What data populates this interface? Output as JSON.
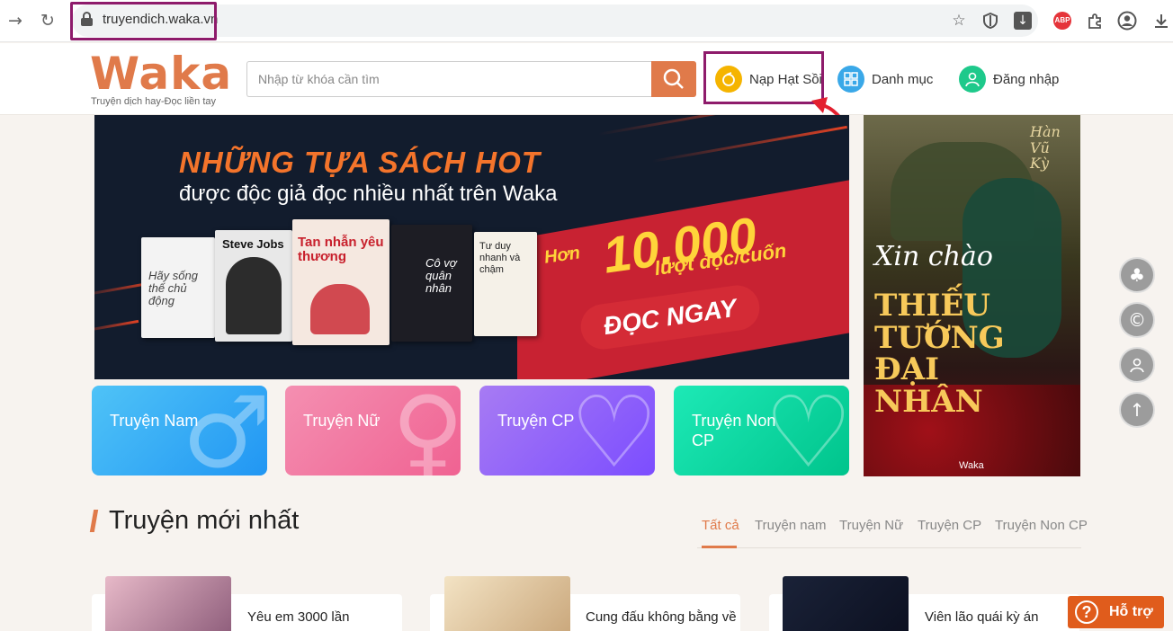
{
  "browser": {
    "back_icon": "back-arrow-icon",
    "reload_icon": "reload-icon",
    "url": "truyendich.waka.vn",
    "toolbar_icons": [
      "star-icon",
      "shield-icon",
      "download-arrow-icon",
      "abp-icon",
      "puzzle-icon",
      "profile-icon",
      "download-icon"
    ],
    "abp_label": "ABP",
    "highlight_color": "#8e1b6b"
  },
  "header": {
    "logo": "Waka",
    "tagline": "Truyện dịch hay-Đọc liền tay",
    "search_placeholder": "Nhập từ khóa cần tìm",
    "nap_label": "Nạp Hạt Sồi",
    "danh_muc_label": "Danh mục",
    "login_label": "Đăng nhập",
    "accent_color": "#e07a4a"
  },
  "banner": {
    "title": "NHỮNG TỰA SÁCH HOT",
    "subtitle": "được độc giả đọc nhiều nhất trên Waka",
    "count_prefix": "Hơn",
    "count": "10.000",
    "count_unit": "lượt đọc/cuốn",
    "cta": "ĐỌC NGAY",
    "books": [
      "Hãy sống thế chủ động",
      "Steve Jobs",
      "Tan nhẫn yêu thương",
      "Cô vợ quân nhân",
      "Tư duy nhanh và chậm"
    ]
  },
  "side_banner": {
    "corner": "Hàn Vũ Kỳ",
    "title_1": "Xin chào",
    "title_2": "THIẾU TƯỚNG ĐẠI NHÂN",
    "brand": "Waka"
  },
  "floating_buttons": [
    "tree-icon",
    "copyright-icon",
    "users-icon",
    "arrow-up-icon"
  ],
  "categories": [
    {
      "label": "Truyện Nam",
      "glyph": "♂",
      "color_from": "#4fc3f7",
      "color_to": "#2196f3"
    },
    {
      "label": "Truyện Nữ",
      "glyph": "♀",
      "color_from": "#f48fb1",
      "color_to": "#f06292"
    },
    {
      "label": "Truyện CP",
      "glyph": "♡",
      "color_from": "#a77bf3",
      "color_to": "#7c4dff"
    },
    {
      "label": "Truyện Non CP",
      "glyph": "♡",
      "color_from": "#1de9b6",
      "color_to": "#00c48c"
    }
  ],
  "section": {
    "title": "Truyện mới nhất",
    "tabs": [
      "Tất cả",
      "Truyện nam",
      "Truyện Nữ",
      "Truyện CP",
      "Truyện Non CP"
    ]
  },
  "stories": [
    {
      "title": "Yêu em 3000 lần"
    },
    {
      "title": "Cung đấu không bằng về"
    },
    {
      "title": "Viên lão quái kỳ án"
    }
  ],
  "help_label": "Hỗ trợ"
}
